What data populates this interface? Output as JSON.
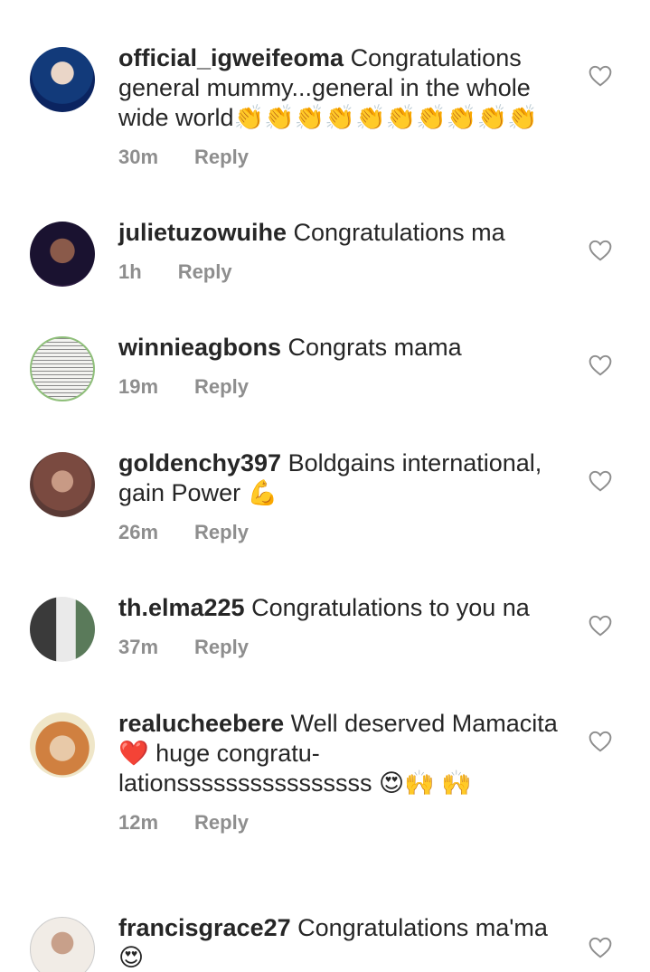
{
  "comments": [
    {
      "username": "official_igweifeoma",
      "text": "Congratulations general mummy...general in the whole wide world👏👏👏👏👏👏👏👏👏👏",
      "time": "30m",
      "reply_label": "Reply",
      "avatar_color": "#1e4fa8"
    },
    {
      "username": "julietuzowuihe",
      "text": "Congratulations ma",
      "time": "1h",
      "reply_label": "Reply",
      "avatar_color": "#3a2a5a"
    },
    {
      "username": "winnieagbons",
      "text": "Congrats mama",
      "time": "19m",
      "reply_label": "Reply",
      "avatar_color": "#e9efe6"
    },
    {
      "username": "goldenchy397",
      "text": "Boldgains international, gain Power 💪",
      "time": "26m",
      "reply_label": "Reply",
      "avatar_color": "#9a6a5a"
    },
    {
      "username": "th.elma225",
      "text": "Congratulations to you na",
      "time": "37m",
      "reply_label": "Reply",
      "avatar_color": "#6a6a6a"
    },
    {
      "username": "realucheebere",
      "text": "Well deserved Mamacita ❤️ huge congratu-lationssssssssssssssss 😍🙌 🙌",
      "time": "12m",
      "reply_label": "Reply",
      "avatar_color": "#c9b483"
    },
    {
      "username": "francisgrace27",
      "text": "Congratulations ma'ma 😍",
      "time": "",
      "reply_label": "",
      "avatar_color": "#d8c6b8"
    }
  ],
  "colors": {
    "text": "#262626",
    "meta": "#8e8e8e",
    "heart_stroke": "#8e8e8e"
  },
  "icons": {
    "like": "heart-outline-icon"
  }
}
